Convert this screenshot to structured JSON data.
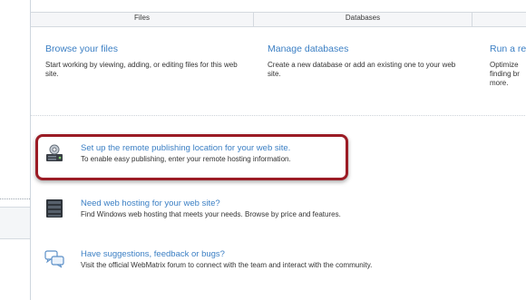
{
  "tabs": {
    "files": "Files",
    "databases": "Databases"
  },
  "cards": {
    "files": {
      "title": "Browse your files",
      "desc": "Start working by viewing, adding, or editing files for this web site."
    },
    "databases": {
      "title": "Manage databases",
      "desc": "Create a new database or add an existing one to your web site."
    },
    "reports": {
      "title": "Run a re",
      "desc": "Optimize finding br more."
    }
  },
  "actions": [
    {
      "title": "Set up the remote publishing location for your web site.",
      "desc": "To enable easy publishing, enter your remote hosting information.",
      "icon": "server-gear-icon"
    },
    {
      "title": "Need web hosting for your web site?",
      "desc": "Find Windows web hosting that meets your needs. Browse by price and features.",
      "icon": "server-icon"
    },
    {
      "title": "Have suggestions, feedback or bugs?",
      "desc": "Visit the official WebMatrix forum to connect with the team and interact with the community.",
      "icon": "chat-bubbles-icon"
    }
  ],
  "colors": {
    "link": "#3b7fc4",
    "highlight": "#9b1c25"
  }
}
